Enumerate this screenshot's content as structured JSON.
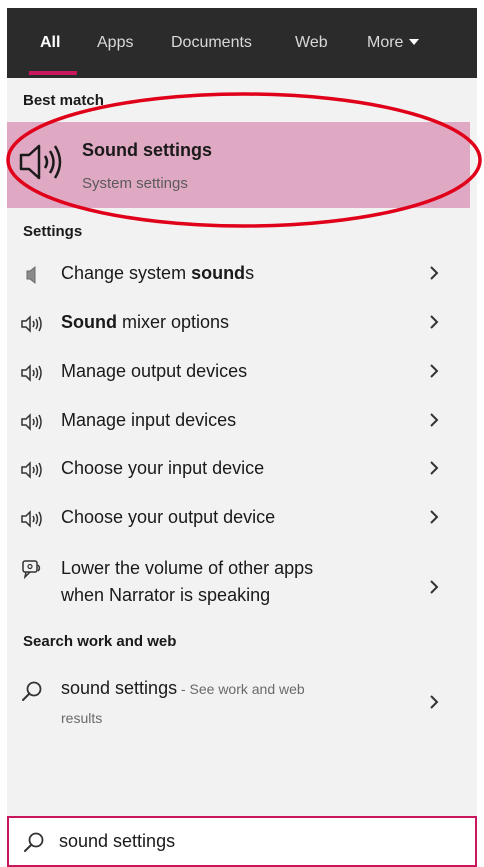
{
  "tabs": [
    {
      "label": "All",
      "active": true
    },
    {
      "label": "Apps"
    },
    {
      "label": "Documents"
    },
    {
      "label": "Web"
    },
    {
      "label": "More"
    }
  ],
  "best_match": {
    "header": "Best match",
    "title": "Sound settings",
    "subtitle": "System settings",
    "icon": "speaker-icon"
  },
  "settings": {
    "header": "Settings",
    "items": [
      {
        "pre": "Change system ",
        "bold": "sound",
        "post": "s",
        "icon": "speaker-low-icon"
      },
      {
        "pre": "",
        "bold": "Sound",
        "post": " mixer options",
        "icon": "speaker-icon"
      },
      {
        "pre": "Manage output devices",
        "bold": "",
        "post": "",
        "icon": "speaker-icon"
      },
      {
        "pre": "Manage input devices",
        "bold": "",
        "post": "",
        "icon": "speaker-icon"
      },
      {
        "pre": "Choose your input device",
        "bold": "",
        "post": "",
        "icon": "speaker-icon"
      },
      {
        "pre": "Choose your output device",
        "bold": "",
        "post": "",
        "icon": "speaker-icon"
      },
      {
        "line1": "Lower the volume of other apps",
        "line2": "when Narrator is speaking",
        "icon": "narrator-icon"
      }
    ]
  },
  "web": {
    "header": "Search work and web",
    "query": "sound settings",
    "hint": " - See work and web",
    "hint_line2": "results",
    "icon": "search-icon"
  },
  "search": {
    "value": "sound settings",
    "icon": "search-icon"
  },
  "colors": {
    "accent": "#c8175d",
    "best_match_bg": "#e0a9c3",
    "tabbar_bg": "#2b2b2b",
    "panel_bg": "#f2f2f2",
    "annotation_ring": "#e0001a"
  }
}
